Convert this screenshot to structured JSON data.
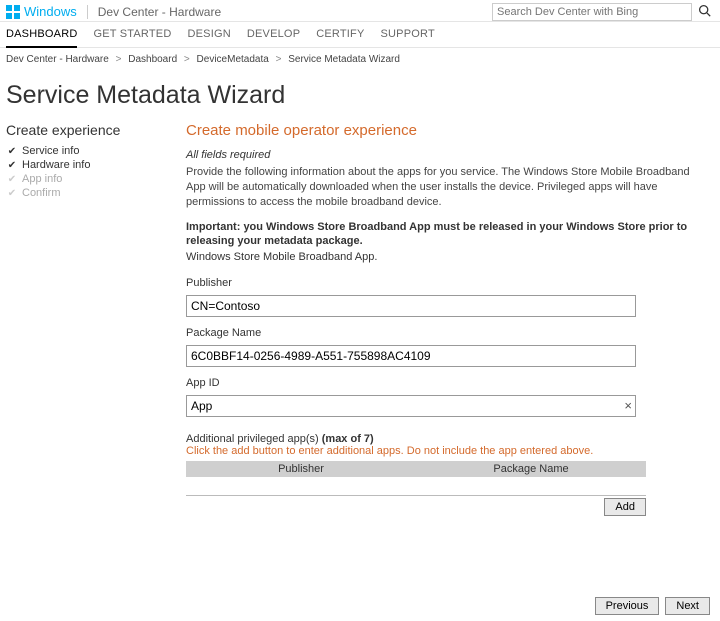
{
  "header": {
    "brand": "Windows",
    "subsite": "Dev Center - Hardware",
    "search_placeholder": "Search Dev Center with Bing"
  },
  "nav": {
    "items": [
      "DASHBOARD",
      "GET STARTED",
      "DESIGN",
      "DEVELOP",
      "CERTIFY",
      "SUPPORT"
    ],
    "active_index": 0
  },
  "breadcrumb": {
    "items": [
      "Dev Center - Hardware",
      "Dashboard",
      "DeviceMetadata",
      "Service Metadata Wizard"
    ]
  },
  "page_title": "Service Metadata Wizard",
  "sidebar": {
    "title": "Create experience",
    "steps": [
      {
        "label": "Service info",
        "done": true
      },
      {
        "label": "Hardware info",
        "done": true
      },
      {
        "label": "App info",
        "done": false
      },
      {
        "label": "Confirm",
        "done": false
      }
    ]
  },
  "form": {
    "section_title": "Create mobile operator experience",
    "required_note": "All fields required",
    "description": "Provide the following information about the apps for you service. The Windows Store Mobile Broadband App will be automatically downloaded when the user installs the device. Privileged apps will have permissions to access the mobile broadband device.",
    "important": "Important: you Windows Store Broadband App must be released in your Windows Store prior to releasing your metadata package.",
    "important_sub": "Windows Store Mobile Broadband App.",
    "fields": {
      "publisher": {
        "label": "Publisher",
        "value": "CN=Contoso"
      },
      "package": {
        "label": "Package Name",
        "value": "6C0BBF14-0256-4989-A551-755898AC4109"
      },
      "appid": {
        "label": "App ID",
        "value": "App"
      }
    },
    "additional": {
      "heading_prefix": "Additional privileged app(s) ",
      "heading_bold": "(max of 7)",
      "hint": "Click the add button to enter additional apps. Do not include the app entered above.",
      "columns": [
        "Publisher",
        "Package Name"
      ],
      "add_label": "Add"
    }
  },
  "footer": {
    "prev_label": "Previous",
    "next_label": "Next"
  }
}
